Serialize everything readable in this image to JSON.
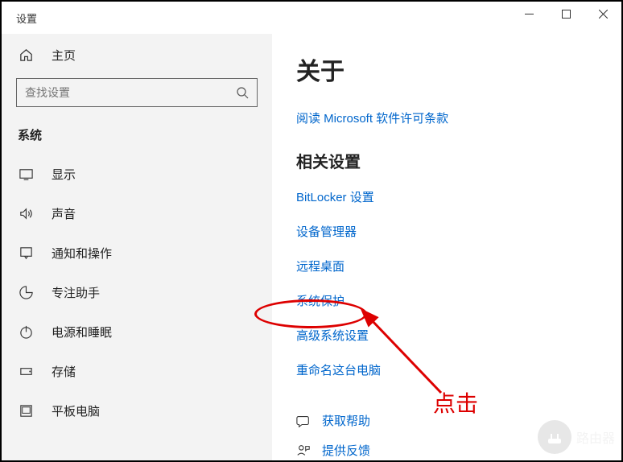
{
  "window": {
    "title": "设置"
  },
  "sidebar": {
    "home": "主页",
    "search_placeholder": "查找设置",
    "section": "系统",
    "items": [
      {
        "label": "显示"
      },
      {
        "label": "声音"
      },
      {
        "label": "通知和操作"
      },
      {
        "label": "专注助手"
      },
      {
        "label": "电源和睡眠"
      },
      {
        "label": "存储"
      },
      {
        "label": "平板电脑"
      }
    ]
  },
  "main": {
    "title": "关于",
    "top_link": "阅读 Microsoft 软件许可条款",
    "related_title": "相关设置",
    "links": [
      "BitLocker 设置",
      "设备管理器",
      "远程桌面",
      "系统保护",
      "高级系统设置",
      "重命名这台电脑"
    ],
    "help": [
      {
        "label": "获取帮助"
      },
      {
        "label": "提供反馈"
      }
    ]
  },
  "annotation": {
    "label": "点击"
  },
  "watermark": {
    "text": "路由器"
  }
}
